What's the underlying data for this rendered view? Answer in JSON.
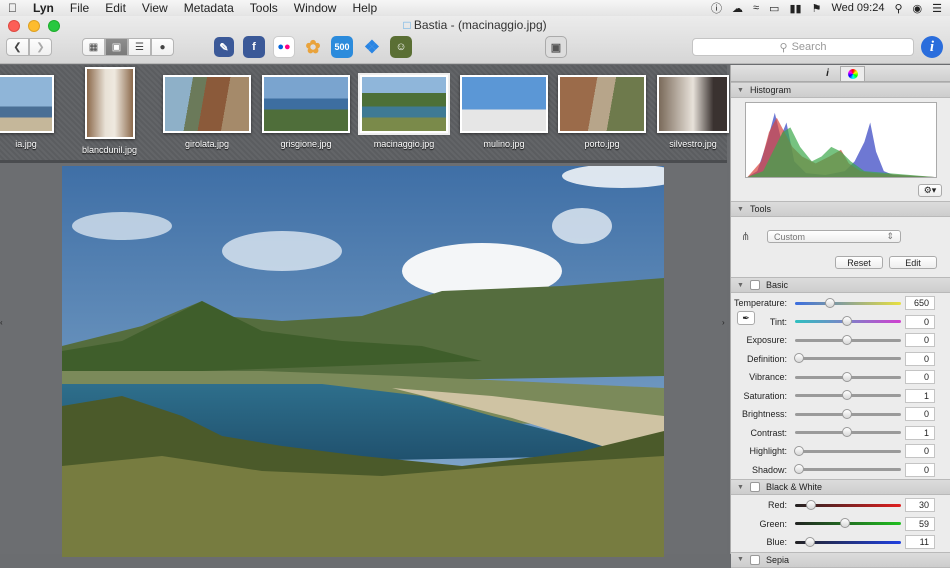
{
  "menubar": {
    "app": "Lyn",
    "items": [
      "File",
      "Edit",
      "View",
      "Metadata",
      "Tools",
      "Window",
      "Help"
    ],
    "clock": "Wed 09:24"
  },
  "window": {
    "title": "Bastia - (macinaggio.jpg)"
  },
  "search": {
    "placeholder": "Search"
  },
  "info_label": "i",
  "share": {
    "px500": "500"
  },
  "thumbnails": [
    {
      "caption": "ia.jpg"
    },
    {
      "caption": "blancdunil.jpg"
    },
    {
      "caption": "girolata.jpg"
    },
    {
      "caption": "grisgione.jpg"
    },
    {
      "caption": "macinaggio.jpg"
    },
    {
      "caption": "mulino.jpg"
    },
    {
      "caption": "porto.jpg"
    },
    {
      "caption": "silvestro.jpg"
    }
  ],
  "panel": {
    "tab_info": "i",
    "histogram": {
      "title": "Histogram"
    },
    "tools": {
      "title": "Tools",
      "preset": "Custom",
      "reset": "Reset",
      "edit": "Edit"
    },
    "basic": {
      "title": "Basic",
      "rows": [
        {
          "label": "Temperature:",
          "value": "650",
          "pos": 0.32
        },
        {
          "label": "Tint:",
          "value": "0",
          "pos": 0.5
        },
        {
          "label": "Exposure:",
          "value": "0",
          "pos": 0.5
        },
        {
          "label": "Definition:",
          "value": "0",
          "pos": 0.0
        },
        {
          "label": "Vibrance:",
          "value": "0",
          "pos": 0.5
        },
        {
          "label": "Saturation:",
          "value": "1",
          "pos": 0.5
        },
        {
          "label": "Brightness:",
          "value": "0",
          "pos": 0.5
        },
        {
          "label": "Contrast:",
          "value": "1",
          "pos": 0.5
        },
        {
          "label": "Highlight:",
          "value": "0",
          "pos": 0.0
        },
        {
          "label": "Shadow:",
          "value": "0",
          "pos": 0.0
        }
      ]
    },
    "bw": {
      "title": "Black & White",
      "rows": [
        {
          "label": "Red:",
          "value": "30",
          "pos": 0.13
        },
        {
          "label": "Green:",
          "value": "59",
          "pos": 0.48
        },
        {
          "label": "Blue:",
          "value": "11",
          "pos": 0.11
        }
      ]
    },
    "sepia": {
      "title": "Sepia"
    }
  }
}
